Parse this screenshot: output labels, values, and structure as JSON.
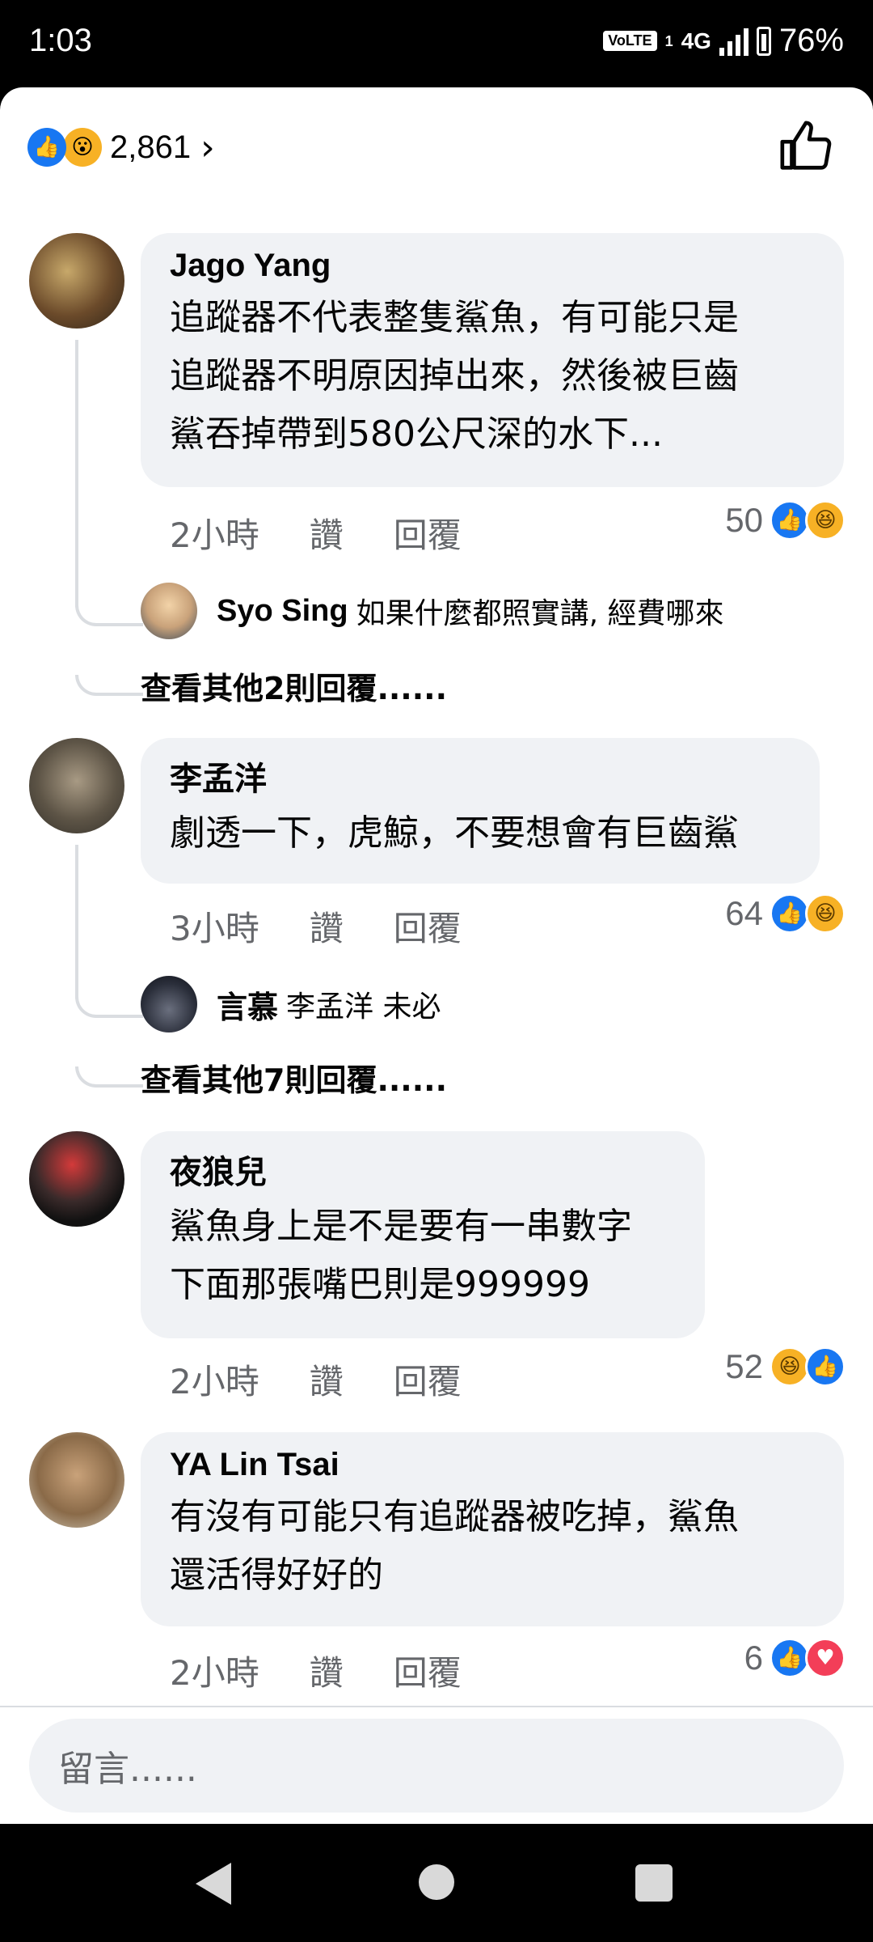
{
  "status_bar": {
    "time": "1:03",
    "volte": "VoLTE",
    "sim": "1",
    "network": "4G",
    "battery": "76%"
  },
  "reactions_summary": {
    "count": "2,861",
    "icons": [
      "like-icon",
      "wow-icon"
    ]
  },
  "comments": [
    {
      "name": "Jago Yang",
      "text_lines": [
        "追蹤器不代表整隻鯊魚，有可能只是",
        "追蹤器不明原因掉出來，然後被巨齒",
        "鯊吞掉帶到580公尺深的水下..."
      ],
      "time": "2小時",
      "like_label": "讚",
      "reply_label": "回覆",
      "reaction_count": "50",
      "reaction_icons": [
        "like-icon",
        "haha-icon"
      ],
      "reply": {
        "name": "Syo Sing",
        "text": "如果什麼都照實講, 經費哪來"
      },
      "more_replies": "查看其他2則回覆......"
    },
    {
      "name": "李孟洋",
      "text_lines": [
        "劇透一下，虎鯨，不要想會有巨齒鯊"
      ],
      "time": "3小時",
      "like_label": "讚",
      "reply_label": "回覆",
      "reaction_count": "64",
      "reaction_icons": [
        "like-icon",
        "haha-icon"
      ],
      "reply": {
        "name": "言慕",
        "text": "李孟洋 未必"
      },
      "more_replies": "查看其他7則回覆......"
    },
    {
      "name": "夜狼兒",
      "text_lines": [
        "鯊魚身上是不是要有一串數字",
        "下面那張嘴巴則是999999"
      ],
      "time": "2小時",
      "like_label": "讚",
      "reply_label": "回覆",
      "reaction_count": "52",
      "reaction_icons": [
        "haha-icon",
        "like-icon"
      ]
    },
    {
      "name": "YA Lin  Tsai",
      "text_lines": [
        "有沒有可能只有追蹤器被吃掉，鯊魚",
        "還活得好好的"
      ],
      "time": "2小時",
      "like_label": "讚",
      "reply_label": "回覆",
      "reaction_count": "6",
      "reaction_icons": [
        "like-icon",
        "love-icon"
      ]
    }
  ],
  "comment_input": {
    "placeholder": "留言......"
  },
  "colors": {
    "facebook_blue": "#1877f2",
    "haha_yellow": "#f7b125",
    "love_red": "#f33e58",
    "bubble_bg": "#f0f2f5"
  }
}
